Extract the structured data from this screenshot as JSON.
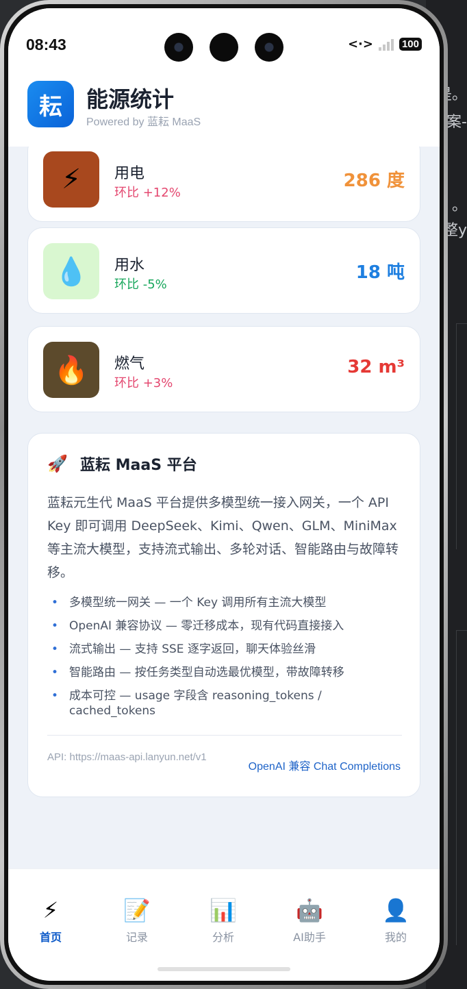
{
  "status": {
    "time": "08:43",
    "battery": "100"
  },
  "header": {
    "logo_char": "耘",
    "title": "能源统计",
    "subtitle": "Powered by 蓝耘 MaaS"
  },
  "metrics": [
    {
      "name": "用电",
      "change": "环比 +12%",
      "value": "286 度",
      "icon": "lightning-icon",
      "change_color": "#e4476f",
      "value_color": "#f0923a",
      "icon_bg": "#a8481e"
    },
    {
      "name": "用水",
      "change": "环比 -5%",
      "value": "18 吨",
      "icon": "water-drop-icon",
      "change_color": "#17a65b",
      "value_color": "#1e7fe0",
      "icon_bg": "#d9f7d0"
    },
    {
      "name": "燃气",
      "change": "环比 +3%",
      "value": "32 m³",
      "icon": "fire-icon",
      "change_color": "#e4476f",
      "value_color": "#e53935",
      "icon_bg": "#5c4a2c"
    }
  ],
  "platform": {
    "title": "蓝耘 MaaS 平台",
    "description": "蓝耘元生代 MaaS 平台提供多模型统一接入网关，一个 API Key 即可调用 DeepSeek、Kimi、Qwen、GLM、MiniMax 等主流大模型，支持流式输出、多轮对话、智能路由与故障转移。",
    "features": [
      "多模型统一网关 — 一个 Key 调用所有主流大模型",
      "OpenAI 兼容协议 — 零迁移成本，现有代码直接接入",
      "流式输出 — 支持 SSE 逐字返回，聊天体验丝滑",
      "智能路由 — 按任务类型自动选最优模型，带故障转移",
      "成本可控 — usage 字段含 reasoning_tokens / cached_tokens"
    ],
    "api": "API: https://maas-api.lanyun.net/v1",
    "link": "OpenAI 兼容 Chat Completions"
  },
  "nav": [
    {
      "label": "首页",
      "icon": "lightning-icon",
      "active": true
    },
    {
      "label": "记录",
      "icon": "memo-icon",
      "active": false
    },
    {
      "label": "分析",
      "icon": "bar-chart-icon",
      "active": false
    },
    {
      "label": "AI助手",
      "icon": "robot-icon",
      "active": false
    },
    {
      "label": "我的",
      "icon": "user-icon",
      "active": false
    }
  ],
  "background": {
    "text_1": "是。",
    "text_2": "案-",
    "text_3": "。",
    "text_4": "整y"
  }
}
